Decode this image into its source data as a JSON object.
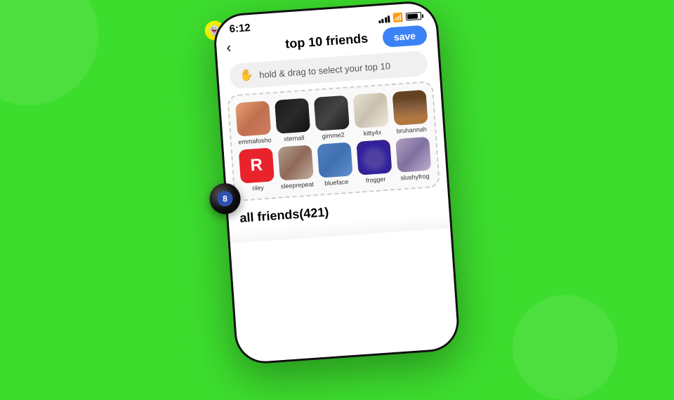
{
  "background_color": "#3ddd2e",
  "status_bar": {
    "time": "6:12",
    "signal": "signal",
    "wifi": "wifi",
    "battery": "battery"
  },
  "header": {
    "back_label": "‹",
    "title": "top 10 friends",
    "save_label": "save"
  },
  "hint": {
    "icon": "✋",
    "text": "hold & drag to select your top 10"
  },
  "top10": {
    "friends": [
      {
        "name": "emmafosho",
        "avatar_class": "av-emmafosho"
      },
      {
        "name": "xternall",
        "avatar_class": "av-xternall"
      },
      {
        "name": "gimme2",
        "avatar_class": "av-gimme2"
      },
      {
        "name": "kitty4x",
        "avatar_class": "av-kitty4x"
      },
      {
        "name": "bruhannah",
        "avatar_class": "av-bruhannah"
      },
      {
        "name": "riley",
        "avatar_class": "av-riley",
        "is_text": true,
        "letter": "R"
      },
      {
        "name": "sleeprepeat",
        "avatar_class": "av-sleeprepeat"
      },
      {
        "name": "blueface",
        "avatar_class": "av-blueface"
      },
      {
        "name": "frogger",
        "avatar_class": "av-frogger"
      },
      {
        "name": "slushyfrog",
        "avatar_class": "av-slushyfrog"
      }
    ]
  },
  "all_friends": {
    "label": "all friends",
    "count": "(421)"
  },
  "magic_ball": {
    "symbol": "8"
  },
  "ghost_emoji": "👻"
}
